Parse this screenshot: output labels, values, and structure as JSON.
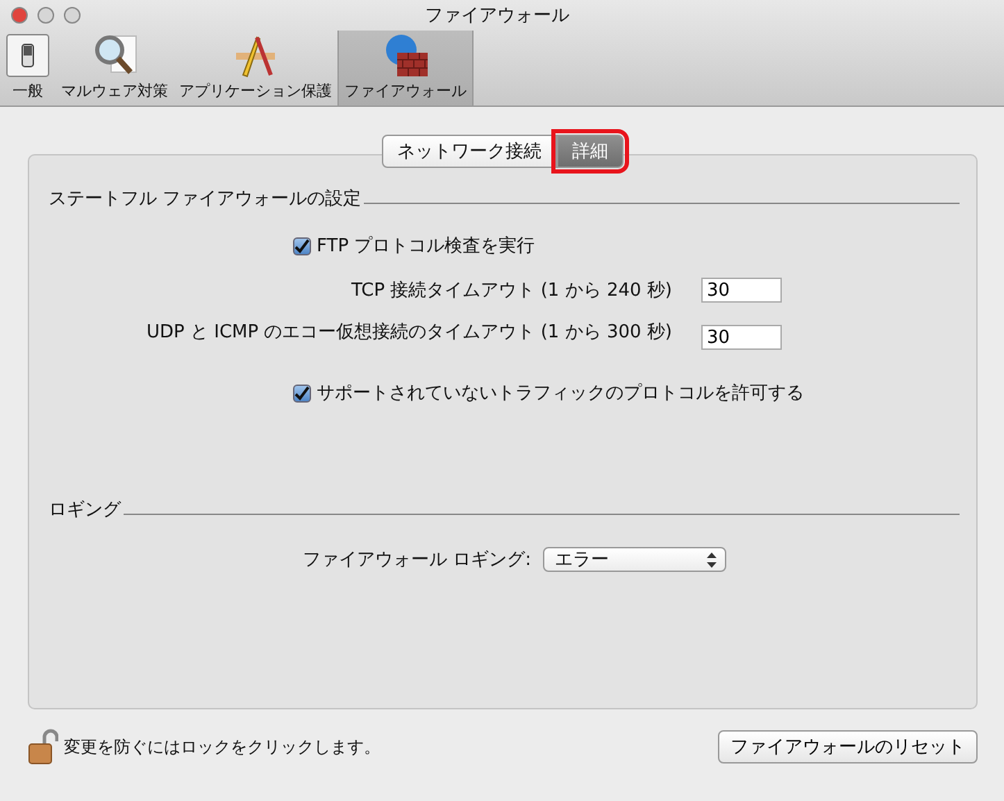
{
  "window": {
    "title": "ファイアウォール"
  },
  "toolbar": [
    {
      "label": "一般",
      "selected": false
    },
    {
      "label": "マルウェア対策",
      "selected": false
    },
    {
      "label": "アプリケーション保護",
      "selected": false
    },
    {
      "label": "ファイアウォール",
      "selected": true
    }
  ],
  "tabs": [
    {
      "label": "ネットワーク接続",
      "selected": false,
      "highlighted": false
    },
    {
      "label": "詳細",
      "selected": true,
      "highlighted": true
    }
  ],
  "stateful": {
    "heading": "ステートフル ファイアウォールの設定",
    "ftp": {
      "label": "FTP プロトコル検査を実行",
      "checked": true
    },
    "tcp": {
      "label": "TCP 接続タイムアウト (1 から 240 秒)",
      "value": "30"
    },
    "udp": {
      "label": "UDP と ICMP のエコー仮想接続のタイムアウト (1 から 300 秒)",
      "value": "30"
    },
    "unsupported": {
      "label": "サポートされていないトラフィックのプロトコルを許可する",
      "checked": true
    }
  },
  "logging": {
    "heading": "ロギング",
    "label": "ファイアウォール ロギング:",
    "value": "エラー"
  },
  "footer": {
    "lock_text": "変更を防ぐにはロックをクリックします。",
    "reset_button": "ファイアウォールのリセット"
  }
}
